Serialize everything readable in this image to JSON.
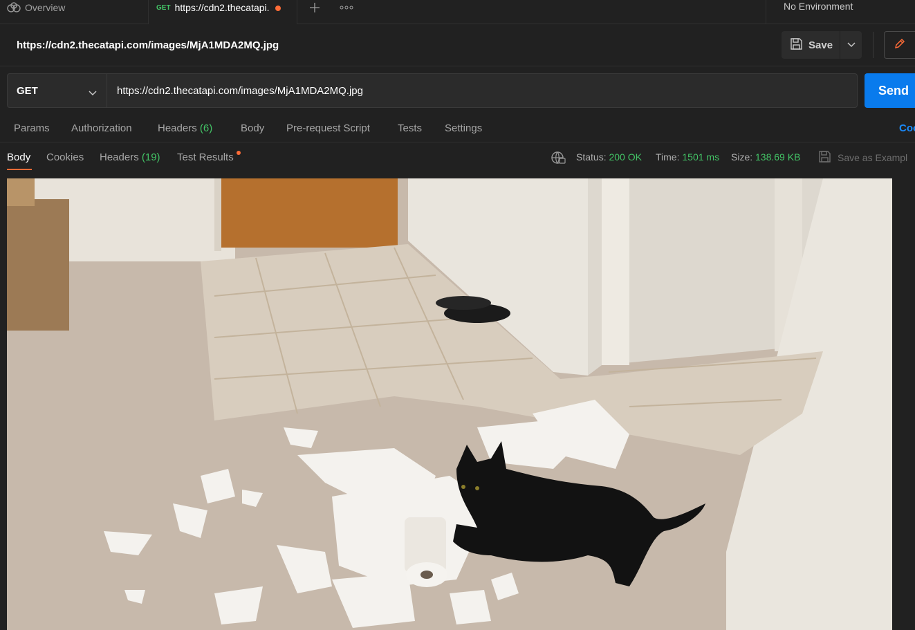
{
  "tabbar": {
    "overview_label": "Overview",
    "active_tab": {
      "method": "GET",
      "title": "https://cdn2.thecatapi."
    },
    "environment": "No Environment"
  },
  "request": {
    "title": "https://cdn2.thecatapi.com/images/MjA1MDA2MQ.jpg",
    "save_label": "Save",
    "method": "GET",
    "url": "https://cdn2.thecatapi.com/images/MjA1MDA2MQ.jpg",
    "send_label": "Send",
    "tabs": {
      "params": "Params",
      "authorization": "Authorization",
      "headers": "Headers",
      "headers_count": "(6)",
      "body": "Body",
      "prerequest": "Pre-request Script",
      "tests": "Tests",
      "settings": "Settings"
    },
    "cookies_link": "Coo"
  },
  "response": {
    "tabs": {
      "body": "Body",
      "cookies": "Cookies",
      "headers": "Headers",
      "headers_count": "(19)",
      "test_results": "Test Results"
    },
    "status_label": "Status:",
    "status_value": "200 OK",
    "time_label": "Time:",
    "time_value": "1501 ms",
    "size_label": "Size:",
    "size_value": "138.69 KB",
    "save_example": "Save as Exampl"
  },
  "colors": {
    "accent_orange": "#ff6c37",
    "send_blue": "#097bed",
    "status_green": "#43c466",
    "link_blue": "#1a8cff"
  },
  "icons": [
    "overview-icon",
    "plus-icon",
    "more-icon",
    "save-icon",
    "chevron-down-icon",
    "pencil-icon",
    "globe-icon",
    "save-example-icon"
  ]
}
